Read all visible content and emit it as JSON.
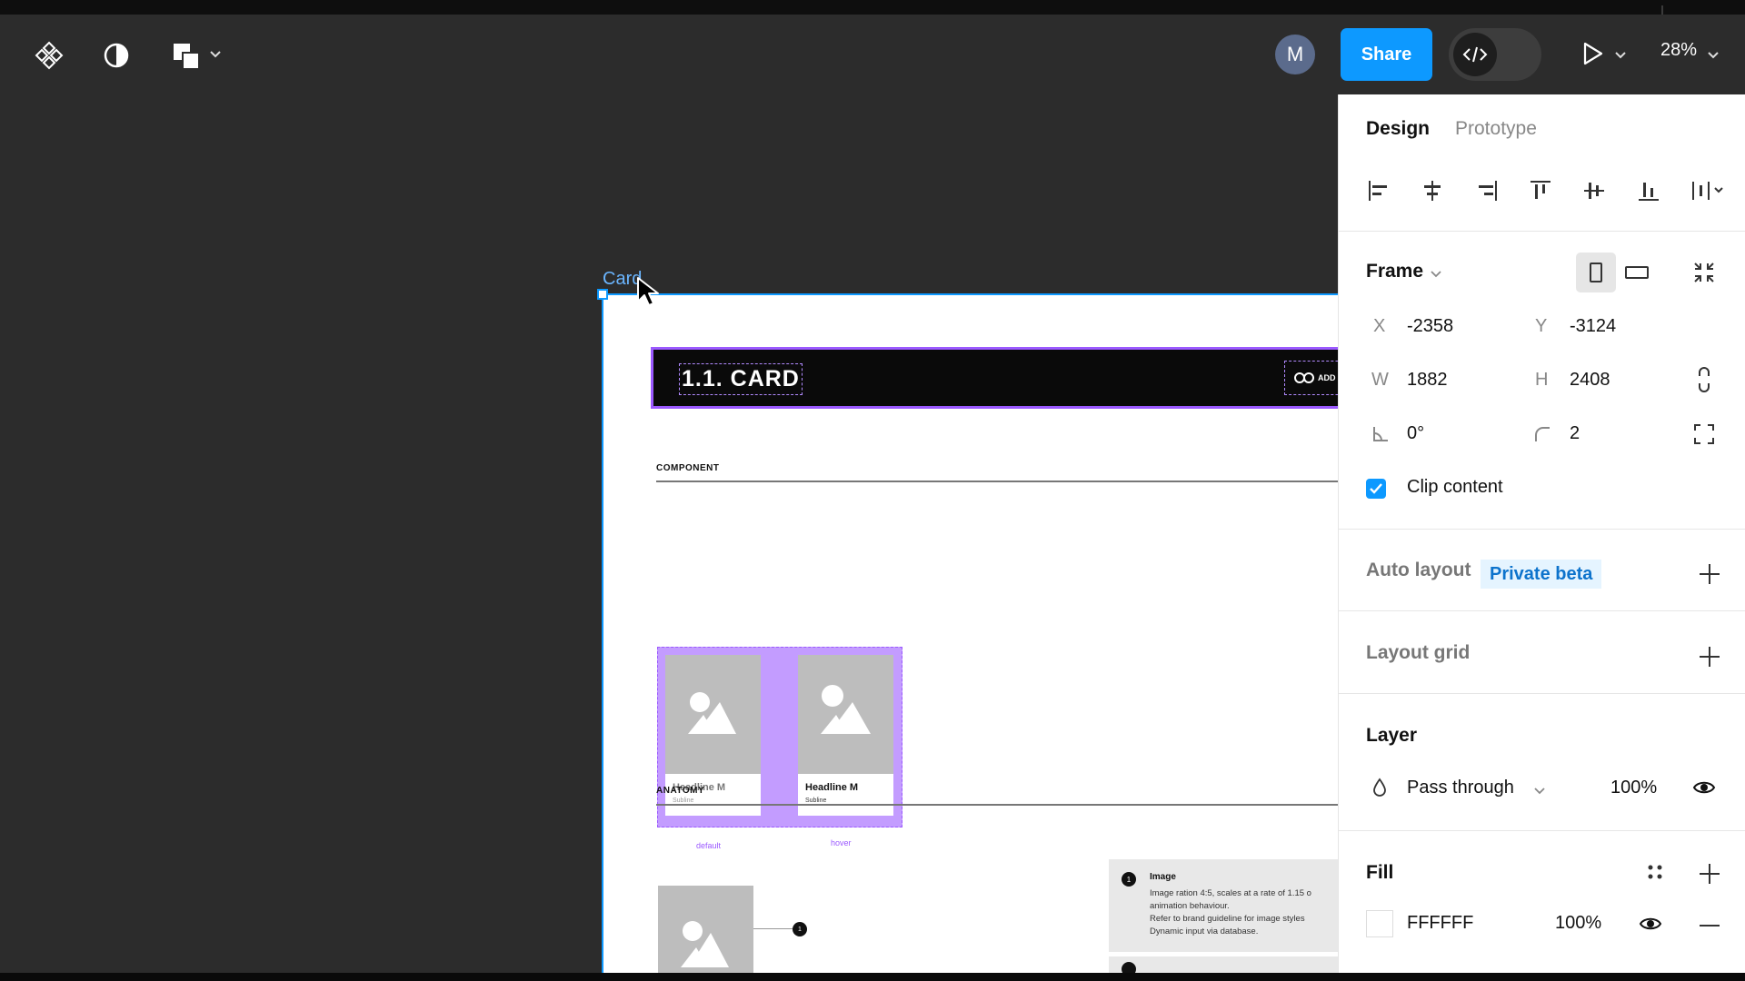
{
  "toolbar": {
    "main_menu_icon": "figma-components-icon",
    "theme_icon": "contrast-icon",
    "shape_tool_icon": "shapes-icon",
    "avatar_initial": "M",
    "share_label": "Share",
    "dev_mode_icon": "code-icon",
    "present_icon": "play-icon",
    "zoom_label": "28%"
  },
  "canvas": {
    "frame_label": "Card",
    "banner_title": "1.1. CARD",
    "banner_link_label": "ADD",
    "section_component": "COMPONENT",
    "section_anatomy": "ANATOMY",
    "variants": [
      {
        "headline": "Headline M",
        "subline": "Subline",
        "state": "default"
      },
      {
        "headline": "Headline M",
        "subline": "Subline",
        "state": "hover"
      }
    ],
    "anatomy_marker": "1",
    "anatomy_note": {
      "number": "1",
      "title": "Image",
      "lines": [
        "Image ration 4:5, scales at a rate of 1.15 o",
        "animation behaviour.",
        "Refer to brand guideline for image styles",
        "Dynamic input via database."
      ]
    }
  },
  "panel": {
    "tabs": {
      "design": "Design",
      "prototype": "Prototype"
    },
    "frame": {
      "title": "Frame",
      "x_label": "X",
      "x_value": "-2358",
      "y_label": "Y",
      "y_value": "-3124",
      "w_label": "W",
      "w_value": "1882",
      "h_label": "H",
      "h_value": "2408",
      "rotation_value": "0°",
      "radius_value": "2",
      "clip_content_label": "Clip content",
      "clip_content_checked": true
    },
    "auto_layout": {
      "title": "Auto layout",
      "badge": "Private beta"
    },
    "layout_grid": {
      "title": "Layout grid"
    },
    "layer": {
      "title": "Layer",
      "blend_mode": "Pass through",
      "opacity": "100%"
    },
    "fill": {
      "title": "Fill",
      "hex": "FFFFFF",
      "opacity": "100%"
    }
  },
  "colors": {
    "accent": "#0d99ff",
    "selection_purple": "#9b59ff",
    "panel_bg": "#ffffff",
    "toolbar_bg": "#2c2c2c"
  }
}
